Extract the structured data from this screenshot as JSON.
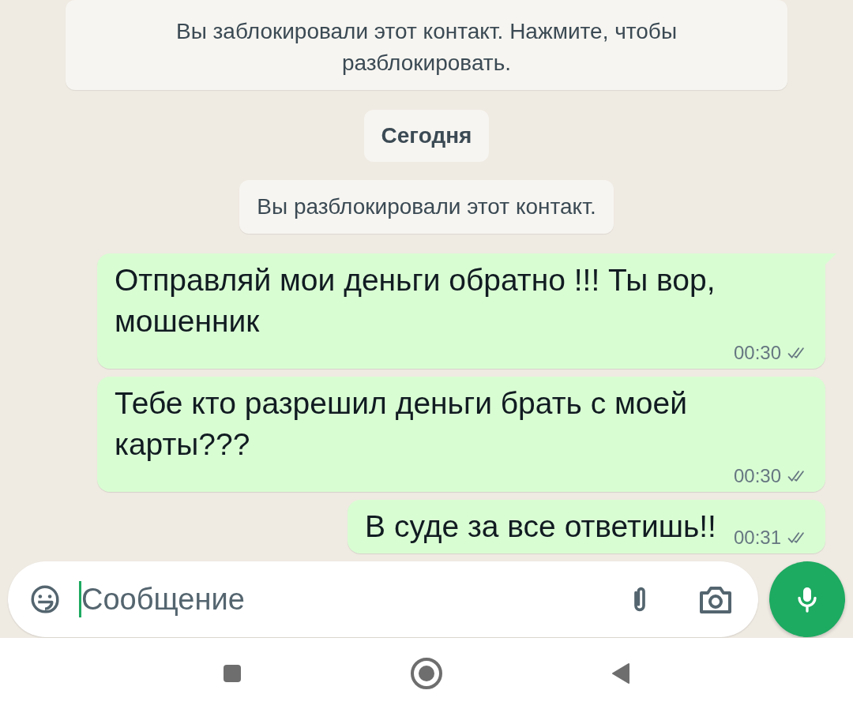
{
  "notices": [
    {
      "kind": "system",
      "text": "Вы заблокировали этот контакт. Нажмите, чтобы разблокировать."
    },
    {
      "kind": "date",
      "text": "Сегодня"
    },
    {
      "kind": "system",
      "text": "Вы разблокировали этот контакт."
    }
  ],
  "messages": [
    {
      "text": "Отправляй мои деньги обратно !!! Ты вор, мошенник",
      "time": "00:30",
      "read": false,
      "tail": true
    },
    {
      "text": "Тебе кто разрешил деньги брать с моей карты???",
      "time": "00:30",
      "read": false,
      "tail": false
    },
    {
      "text": "В суде за все ответишь!!",
      "time": "00:31",
      "read": false,
      "tail": false
    }
  ],
  "composer": {
    "placeholder": "Сообщение"
  }
}
